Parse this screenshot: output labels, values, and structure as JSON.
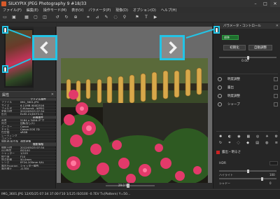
{
  "title_bar": {
    "title": "SILKYPIX JPEG Photography 9   #18/33",
    "minimize": "–",
    "maximize": "□",
    "close": "✕"
  },
  "menu": [
    "ファイル(F)",
    "編集(E)",
    "操作モード(M)",
    "表示(V)",
    "パラメータ(P)",
    "現像(D)",
    "オプション(O)",
    "ヘルプ(H)"
  ],
  "left_panel": {
    "info_title": "属性",
    "info_close": "✕",
    "rows": [
      {
        "k": "",
        "v": "ファイル属性",
        "sec": true
      },
      {
        "k": "ファイル",
        "v": "IMG_3601.JPG"
      },
      {
        "k": "サイズ",
        "v": "6.11MB (6402516"
      },
      {
        "k": "フォルダ",
        "v": "C:¥Users¥...¥JPEG"
      },
      {
        "k": "更新日時",
        "v": "2012/05/25 07:34"
      },
      {
        "k": "形式",
        "v": "Exif2.21(DCF2.0)"
      },
      {
        "k": "",
        "v": "画像属性",
        "sec": true
      },
      {
        "k": "画素",
        "v": "5184 x 3456 (ピク"
      },
      {
        "k": "向き",
        "v": "回転なし(1)"
      },
      {
        "k": "メーカー",
        "v": "Canon"
      },
      {
        "k": "モデル",
        "v": "Canon EOS 7D"
      },
      {
        "k": "色空間",
        "v": "sRGB"
      },
      {
        "k": "レーティング",
        "v": ""
      },
      {
        "k": "コメント",
        "v": ""
      },
      {
        "k": "撮影者/著作権",
        "v": "通常現像"
      },
      {
        "k": "",
        "v": "撮影情報",
        "sec": true
      },
      {
        "k": "撮影日時",
        "v": "2012/05/25 07:34"
      },
      {
        "k": "ISO感度",
        "v": "ISO100"
      },
      {
        "k": "シャッター",
        "v": "1/125"
      },
      {
        "k": "絞り値",
        "v": "F10"
      },
      {
        "k": "焦点距離",
        "v": "50.0mm"
      },
      {
        "k": "レンズ",
        "v": "EF24-105mm f/4L"
      },
      {
        "k": "露出Program",
        "v": "シャッター優先"
      },
      {
        "k": "露出補正",
        "v": "-0.7EV"
      }
    ]
  },
  "center": {
    "zoom": "29.0 %"
  },
  "right_panel": {
    "title": "パラメータ・コントロール",
    "close": "✕",
    "preset": "標準",
    "btn_init": "初期化",
    "btn_auto": "自動調整",
    "val1": "0.00",
    "rows": [
      "明度調整",
      "露出",
      "明度調整",
      "シャープ"
    ],
    "section": "露出・明るさ",
    "hdr_label": "HDR",
    "hdr_val": "",
    "highlight_label": "ハイライト",
    "highlight_val": "100",
    "shadow_label": "シャドー",
    "shadow_val": "0"
  },
  "status": "IMG_3601.JPG 12/05/25 07:34 37.00 F10 1/125 ISO100 -0.7EV Tv(Pattern) Y=50...",
  "colors": {
    "accent": "#23c4e6",
    "panel": "#262626",
    "canvas": "#6a6a6a"
  }
}
